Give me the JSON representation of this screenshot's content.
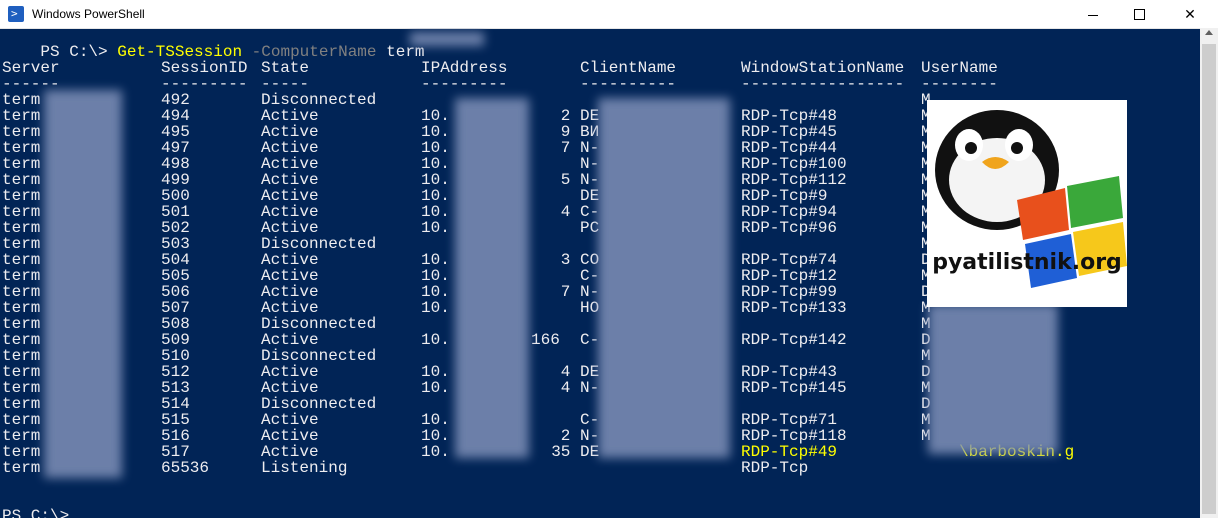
{
  "window": {
    "title": "Windows PowerShell"
  },
  "console": {
    "prompt": "PS C:\\>",
    "command": "Get-TSSession",
    "param": "-ComputerName",
    "arg": "term",
    "headers": [
      "Server",
      "SessionID",
      "State",
      "IPAddress",
      "ClientName",
      "WindowStationName",
      "UserName"
    ],
    "underlines": [
      "------",
      "---------",
      "-----",
      "---------",
      "----------",
      "-----------------",
      "--------"
    ],
    "rows": [
      {
        "server": "term",
        "id": "492",
        "state": "Disconnected",
        "ip": "",
        "client": "",
        "station": "",
        "user": "M"
      },
      {
        "server": "term",
        "id": "494",
        "state": "Active",
        "ip": "10.",
        "ip_tail": "2",
        "client": "DE",
        "station": "RDP-Tcp#48",
        "user": "M"
      },
      {
        "server": "term",
        "id": "495",
        "state": "Active",
        "ip": "10.",
        "ip_tail": "9",
        "client": "ВИ",
        "station": "RDP-Tcp#45",
        "user": "M"
      },
      {
        "server": "term",
        "id": "497",
        "state": "Active",
        "ip": "10.",
        "ip_tail": "7",
        "client": "N-",
        "station": "RDP-Tcp#44",
        "user": "M"
      },
      {
        "server": "term",
        "id": "498",
        "state": "Active",
        "ip": "10.",
        "ip_tail": "",
        "client": "N-",
        "station": "RDP-Tcp#100",
        "user": "M"
      },
      {
        "server": "term",
        "id": "499",
        "state": "Active",
        "ip": "10.",
        "ip_tail": "5",
        "client": "N-",
        "station": "RDP-Tcp#112",
        "user": "M"
      },
      {
        "server": "term",
        "id": "500",
        "state": "Active",
        "ip": "10.",
        "ip_tail": "",
        "client": "DE",
        "station": "RDP-Tcp#9",
        "user": "M"
      },
      {
        "server": "term",
        "id": "501",
        "state": "Active",
        "ip": "10.",
        "ip_tail": "4",
        "client": "C-",
        "station": "RDP-Tcp#94",
        "user": "M"
      },
      {
        "server": "term",
        "id": "502",
        "state": "Active",
        "ip": "10.",
        "ip_tail": "",
        "client": "PC",
        "station": "RDP-Tcp#96",
        "user": "M"
      },
      {
        "server": "term",
        "id": "503",
        "state": "Disconnected",
        "ip": "",
        "client": "",
        "station": "",
        "user": "M"
      },
      {
        "server": "term",
        "id": "504",
        "state": "Active",
        "ip": "10.",
        "ip_tail": "3",
        "client": "CO",
        "station": "RDP-Tcp#74",
        "user": "D"
      },
      {
        "server": "term",
        "id": "505",
        "state": "Active",
        "ip": "10.",
        "ip_tail": "",
        "client": "C-",
        "station": "RDP-Tcp#12",
        "user": "M"
      },
      {
        "server": "term",
        "id": "506",
        "state": "Active",
        "ip": "10.",
        "ip_tail": "7",
        "client": "N-",
        "station": "RDP-Tcp#99",
        "user": "D"
      },
      {
        "server": "term",
        "id": "507",
        "state": "Active",
        "ip": "10.",
        "ip_tail": "",
        "client": "HO",
        "station": "RDP-Tcp#133",
        "user": "M"
      },
      {
        "server": "term",
        "id": "508",
        "state": "Disconnected",
        "ip": "",
        "client": "",
        "station": "",
        "user": "M"
      },
      {
        "server": "term",
        "id": "509",
        "state": "Active",
        "ip": "10.",
        "ip_tail": "166",
        "client": "C-",
        "station": "RDP-Tcp#142",
        "user": "D"
      },
      {
        "server": "term",
        "id": "510",
        "state": "Disconnected",
        "ip": "",
        "client": "",
        "station": "",
        "user": "M"
      },
      {
        "server": "term",
        "id": "512",
        "state": "Active",
        "ip": "10.",
        "ip_tail": "4",
        "client": "DE",
        "station": "RDP-Tcp#43",
        "user": "D"
      },
      {
        "server": "term",
        "id": "513",
        "state": "Active",
        "ip": "10.",
        "ip_tail": "4",
        "client": "N-",
        "station": "RDP-Tcp#145",
        "user": "M"
      },
      {
        "server": "term",
        "id": "514",
        "state": "Disconnected",
        "ip": "",
        "client": "",
        "station": "",
        "user": "D"
      },
      {
        "server": "term",
        "id": "515",
        "state": "Active",
        "ip": "10.",
        "ip_tail": "",
        "client": "C-",
        "station": "RDP-Tcp#71",
        "user": "M"
      },
      {
        "server": "term",
        "id": "516",
        "state": "Active",
        "ip": "10.",
        "ip_tail": "2",
        "client": "N-",
        "station": "RDP-Tcp#118",
        "user": "M"
      },
      {
        "server": "term",
        "id": "517",
        "state": "Active",
        "ip": "10.",
        "ip_tail": "35",
        "client": "DE",
        "station": "RDP-Tcp#49",
        "user": "\\barboskin.g",
        "highlight": true
      },
      {
        "server": "term",
        "id": "65536",
        "state": "Listening",
        "ip": "",
        "client": "",
        "station": "RDP-Tcp",
        "user": ""
      }
    ],
    "final_prompt": "PS C:\\>"
  },
  "logo": {
    "text": "pyatilistnik.org"
  },
  "colors": {
    "background": "#012456",
    "text": "#eeedf0",
    "highlight": "#ffff00",
    "param": "#808080"
  }
}
